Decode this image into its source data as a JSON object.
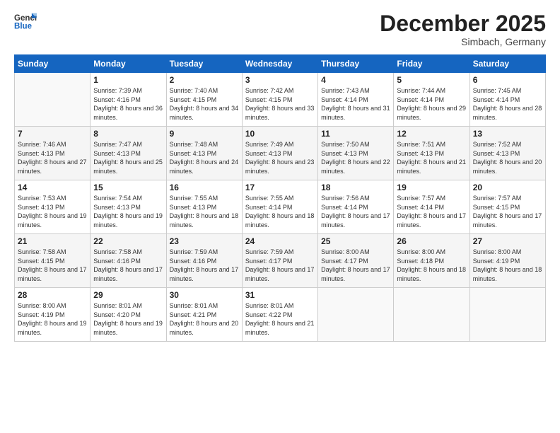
{
  "logo": {
    "line1": "General",
    "line2": "Blue"
  },
  "title": "December 2025",
  "subtitle": "Simbach, Germany",
  "days_of_week": [
    "Sunday",
    "Monday",
    "Tuesday",
    "Wednesday",
    "Thursday",
    "Friday",
    "Saturday"
  ],
  "weeks": [
    [
      {
        "num": "",
        "sunrise": "",
        "sunset": "",
        "daylight": ""
      },
      {
        "num": "1",
        "sunrise": "Sunrise: 7:39 AM",
        "sunset": "Sunset: 4:16 PM",
        "daylight": "Daylight: 8 hours and 36 minutes."
      },
      {
        "num": "2",
        "sunrise": "Sunrise: 7:40 AM",
        "sunset": "Sunset: 4:15 PM",
        "daylight": "Daylight: 8 hours and 34 minutes."
      },
      {
        "num": "3",
        "sunrise": "Sunrise: 7:42 AM",
        "sunset": "Sunset: 4:15 PM",
        "daylight": "Daylight: 8 hours and 33 minutes."
      },
      {
        "num": "4",
        "sunrise": "Sunrise: 7:43 AM",
        "sunset": "Sunset: 4:14 PM",
        "daylight": "Daylight: 8 hours and 31 minutes."
      },
      {
        "num": "5",
        "sunrise": "Sunrise: 7:44 AM",
        "sunset": "Sunset: 4:14 PM",
        "daylight": "Daylight: 8 hours and 29 minutes."
      },
      {
        "num": "6",
        "sunrise": "Sunrise: 7:45 AM",
        "sunset": "Sunset: 4:14 PM",
        "daylight": "Daylight: 8 hours and 28 minutes."
      }
    ],
    [
      {
        "num": "7",
        "sunrise": "Sunrise: 7:46 AM",
        "sunset": "Sunset: 4:13 PM",
        "daylight": "Daylight: 8 hours and 27 minutes."
      },
      {
        "num": "8",
        "sunrise": "Sunrise: 7:47 AM",
        "sunset": "Sunset: 4:13 PM",
        "daylight": "Daylight: 8 hours and 25 minutes."
      },
      {
        "num": "9",
        "sunrise": "Sunrise: 7:48 AM",
        "sunset": "Sunset: 4:13 PM",
        "daylight": "Daylight: 8 hours and 24 minutes."
      },
      {
        "num": "10",
        "sunrise": "Sunrise: 7:49 AM",
        "sunset": "Sunset: 4:13 PM",
        "daylight": "Daylight: 8 hours and 23 minutes."
      },
      {
        "num": "11",
        "sunrise": "Sunrise: 7:50 AM",
        "sunset": "Sunset: 4:13 PM",
        "daylight": "Daylight: 8 hours and 22 minutes."
      },
      {
        "num": "12",
        "sunrise": "Sunrise: 7:51 AM",
        "sunset": "Sunset: 4:13 PM",
        "daylight": "Daylight: 8 hours and 21 minutes."
      },
      {
        "num": "13",
        "sunrise": "Sunrise: 7:52 AM",
        "sunset": "Sunset: 4:13 PM",
        "daylight": "Daylight: 8 hours and 20 minutes."
      }
    ],
    [
      {
        "num": "14",
        "sunrise": "Sunrise: 7:53 AM",
        "sunset": "Sunset: 4:13 PM",
        "daylight": "Daylight: 8 hours and 19 minutes."
      },
      {
        "num": "15",
        "sunrise": "Sunrise: 7:54 AM",
        "sunset": "Sunset: 4:13 PM",
        "daylight": "Daylight: 8 hours and 19 minutes."
      },
      {
        "num": "16",
        "sunrise": "Sunrise: 7:55 AM",
        "sunset": "Sunset: 4:13 PM",
        "daylight": "Daylight: 8 hours and 18 minutes."
      },
      {
        "num": "17",
        "sunrise": "Sunrise: 7:55 AM",
        "sunset": "Sunset: 4:14 PM",
        "daylight": "Daylight: 8 hours and 18 minutes."
      },
      {
        "num": "18",
        "sunrise": "Sunrise: 7:56 AM",
        "sunset": "Sunset: 4:14 PM",
        "daylight": "Daylight: 8 hours and 17 minutes."
      },
      {
        "num": "19",
        "sunrise": "Sunrise: 7:57 AM",
        "sunset": "Sunset: 4:14 PM",
        "daylight": "Daylight: 8 hours and 17 minutes."
      },
      {
        "num": "20",
        "sunrise": "Sunrise: 7:57 AM",
        "sunset": "Sunset: 4:15 PM",
        "daylight": "Daylight: 8 hours and 17 minutes."
      }
    ],
    [
      {
        "num": "21",
        "sunrise": "Sunrise: 7:58 AM",
        "sunset": "Sunset: 4:15 PM",
        "daylight": "Daylight: 8 hours and 17 minutes."
      },
      {
        "num": "22",
        "sunrise": "Sunrise: 7:58 AM",
        "sunset": "Sunset: 4:16 PM",
        "daylight": "Daylight: 8 hours and 17 minutes."
      },
      {
        "num": "23",
        "sunrise": "Sunrise: 7:59 AM",
        "sunset": "Sunset: 4:16 PM",
        "daylight": "Daylight: 8 hours and 17 minutes."
      },
      {
        "num": "24",
        "sunrise": "Sunrise: 7:59 AM",
        "sunset": "Sunset: 4:17 PM",
        "daylight": "Daylight: 8 hours and 17 minutes."
      },
      {
        "num": "25",
        "sunrise": "Sunrise: 8:00 AM",
        "sunset": "Sunset: 4:17 PM",
        "daylight": "Daylight: 8 hours and 17 minutes."
      },
      {
        "num": "26",
        "sunrise": "Sunrise: 8:00 AM",
        "sunset": "Sunset: 4:18 PM",
        "daylight": "Daylight: 8 hours and 18 minutes."
      },
      {
        "num": "27",
        "sunrise": "Sunrise: 8:00 AM",
        "sunset": "Sunset: 4:19 PM",
        "daylight": "Daylight: 8 hours and 18 minutes."
      }
    ],
    [
      {
        "num": "28",
        "sunrise": "Sunrise: 8:00 AM",
        "sunset": "Sunset: 4:19 PM",
        "daylight": "Daylight: 8 hours and 19 minutes."
      },
      {
        "num": "29",
        "sunrise": "Sunrise: 8:01 AM",
        "sunset": "Sunset: 4:20 PM",
        "daylight": "Daylight: 8 hours and 19 minutes."
      },
      {
        "num": "30",
        "sunrise": "Sunrise: 8:01 AM",
        "sunset": "Sunset: 4:21 PM",
        "daylight": "Daylight: 8 hours and 20 minutes."
      },
      {
        "num": "31",
        "sunrise": "Sunrise: 8:01 AM",
        "sunset": "Sunset: 4:22 PM",
        "daylight": "Daylight: 8 hours and 21 minutes."
      },
      {
        "num": "",
        "sunrise": "",
        "sunset": "",
        "daylight": ""
      },
      {
        "num": "",
        "sunrise": "",
        "sunset": "",
        "daylight": ""
      },
      {
        "num": "",
        "sunrise": "",
        "sunset": "",
        "daylight": ""
      }
    ]
  ]
}
